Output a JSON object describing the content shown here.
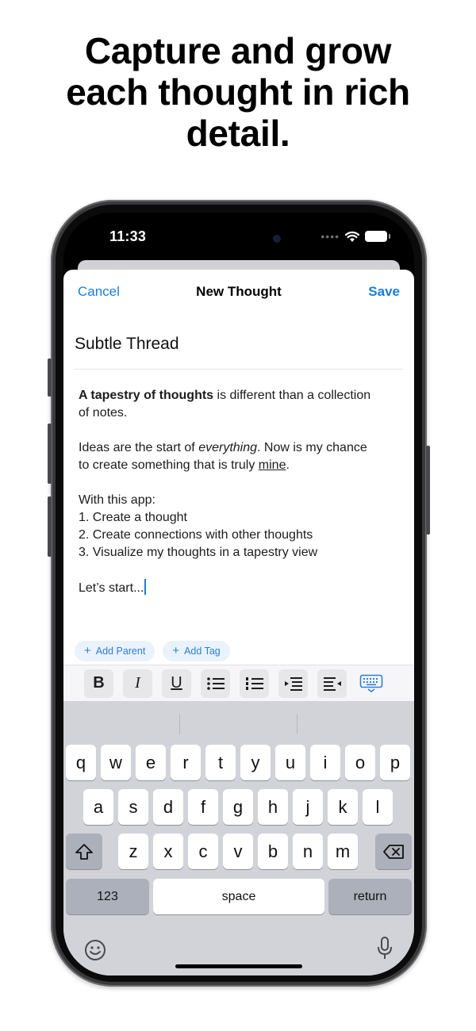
{
  "headline": {
    "line1": "Capture and grow",
    "line2": "each thought in rich",
    "line3": "detail."
  },
  "status_bar": {
    "time": "11:33",
    "signal": "••••"
  },
  "nav": {
    "cancel": "Cancel",
    "title": "New Thought",
    "save": "Save"
  },
  "editor": {
    "title": "Subtle Thread",
    "p1_bold": "A tapestry of thoughts",
    "p1_rest_a": " is different than a collection",
    "p1_rest_b": "of notes.",
    "p2_a": "Ideas are the start of ",
    "p2_italic": "everything",
    "p2_b": ". Now is my chance",
    "p2_c": "to create something that is truly ",
    "p2_underline": "mine",
    "p2_end": ".",
    "p3_intro": "With this app:",
    "list": [
      "1. Create a thought",
      "2. Create connections with other thoughts",
      "3. Visualize my thoughts in a tapestry view"
    ],
    "closing": "Let’s start..."
  },
  "chips": {
    "add_parent": "Add Parent",
    "add_tag": "Add Tag",
    "plus": "+"
  },
  "format_bar": {
    "bold": "B",
    "italic": "I",
    "underline": "U",
    "icons": [
      "bullet-list-icon",
      "numbered-list-icon",
      "indent-icon",
      "outdent-icon",
      "keyboard-dismiss-icon"
    ]
  },
  "keyboard": {
    "row1": [
      "q",
      "w",
      "e",
      "r",
      "t",
      "y",
      "u",
      "i",
      "o",
      "p"
    ],
    "row2": [
      "a",
      "s",
      "d",
      "f",
      "g",
      "h",
      "j",
      "k",
      "l"
    ],
    "row3": [
      "z",
      "x",
      "c",
      "v",
      "b",
      "n",
      "m"
    ],
    "numbers": "123",
    "space": "space",
    "return": "return",
    "icons": [
      "shift-icon",
      "delete-icon",
      "emoji-icon",
      "microphone-icon"
    ]
  },
  "colors": {
    "accent": "#1a7fd6",
    "keyboard_bg": "#d1d3d9",
    "chip_bg": "#eaf2fb"
  }
}
